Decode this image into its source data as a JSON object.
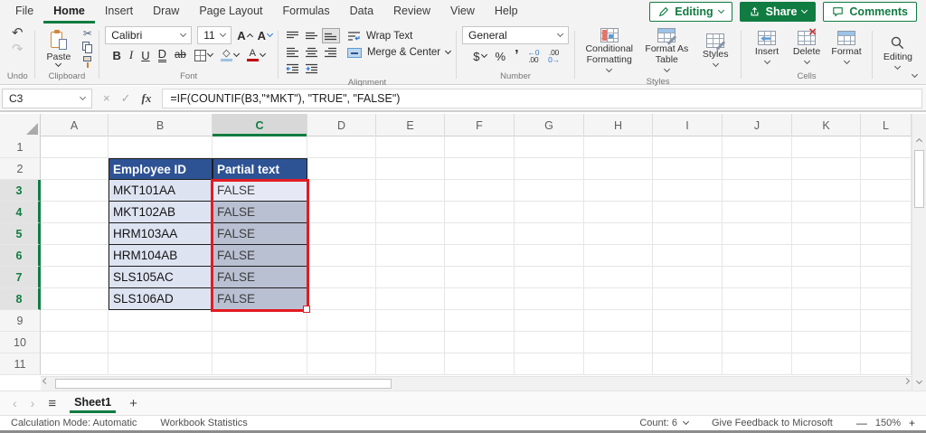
{
  "colors": {
    "accent_green": "#107c41",
    "table_header_blue": "#2e5395",
    "cell_fill": "#dde3f1",
    "selection_fill": "#b9c0d2",
    "active_cell_fill": "#e6e9f5",
    "selection_border_red": "#e31b23"
  },
  "ribbon_tabs": [
    {
      "label": "File",
      "active": false
    },
    {
      "label": "Home",
      "active": true
    },
    {
      "label": "Insert",
      "active": false
    },
    {
      "label": "Draw",
      "active": false
    },
    {
      "label": "Page Layout",
      "active": false
    },
    {
      "label": "Formulas",
      "active": false
    },
    {
      "label": "Data",
      "active": false
    },
    {
      "label": "Review",
      "active": false
    },
    {
      "label": "View",
      "active": false
    },
    {
      "label": "Help",
      "active": false
    }
  ],
  "top_actions": {
    "editing": "Editing",
    "share": "Share",
    "comments": "Comments"
  },
  "ribbon": {
    "undo_label": "Undo",
    "clipboard": {
      "paste": "Paste",
      "label": "Clipboard"
    },
    "font": {
      "family": "Calibri",
      "size": "11",
      "label": "Font"
    },
    "alignment": {
      "wrap_text": "Wrap Text",
      "merge_center": "Merge & Center",
      "label": "Alignment"
    },
    "number": {
      "format": "General",
      "label": "Number"
    },
    "styles": {
      "conditional": "Conditional Formatting",
      "format_table": "Format As Table",
      "styles": "Styles",
      "label": "Styles"
    },
    "cells": {
      "insert": "Insert",
      "delete": "Delete",
      "format": "Format",
      "label": "Cells"
    },
    "editing_button": "Editing"
  },
  "formula_bar": {
    "name_box": "C3",
    "fx": "fx",
    "formula": "=IF(COUNTIF(B3,\"*MKT\"), \"TRUE\", \"FALSE\")"
  },
  "grid": {
    "columns": [
      "A",
      "B",
      "C",
      "D",
      "E",
      "F",
      "G",
      "H",
      "I",
      "J",
      "K",
      "L"
    ],
    "selected_column": "C",
    "rows": [
      "1",
      "2",
      "3",
      "4",
      "5",
      "6",
      "7",
      "8",
      "9",
      "10",
      "11"
    ],
    "selected_rows": [
      "3",
      "4",
      "5",
      "6",
      "7",
      "8"
    ],
    "active_cell": "C3",
    "table": {
      "header_row": "2",
      "headers": [
        "Employee ID",
        "Partial text"
      ],
      "rows": [
        {
          "id": "MKT101AA",
          "value": "FALSE"
        },
        {
          "id": "MKT102AB",
          "value": "FALSE"
        },
        {
          "id": "HRM103AA",
          "value": "FALSE"
        },
        {
          "id": "HRM104AB",
          "value": "FALSE"
        },
        {
          "id": "SLS105AC",
          "value": "FALSE"
        },
        {
          "id": "SLS106AD",
          "value": "FALSE"
        }
      ]
    }
  },
  "sheet_bar": {
    "sheet_name": "Sheet1"
  },
  "status_bar": {
    "calculation_mode": "Calculation Mode: Automatic",
    "workbook_statistics": "Workbook Statistics",
    "count": "Count: 6",
    "feedback": "Give Feedback to Microsoft",
    "zoom_level": "150%"
  },
  "icons": {
    "undo": "↶",
    "redo": "↷",
    "cut": "✂",
    "bold": "B",
    "italic": "I",
    "underline": "U",
    "double_underline": "D",
    "strike": "ab",
    "grow_font": "A",
    "shrink_font": "A",
    "fill_glyph": "◇",
    "font_color_glyph": "A",
    "dollar": "$",
    "percent": "%",
    "comma": "’",
    "inc_decimal_top": "←0",
    "inc_decimal_bottom": ".00",
    "dec_decimal_top": ".00",
    "dec_decimal_bottom": "0→",
    "cancel": "×",
    "check": "✓",
    "prev_sheet": "‹",
    "next_sheet": "›",
    "sheet_menu": "≡",
    "add_sheet": "+",
    "zoom_out": "—",
    "zoom_in": "+"
  }
}
